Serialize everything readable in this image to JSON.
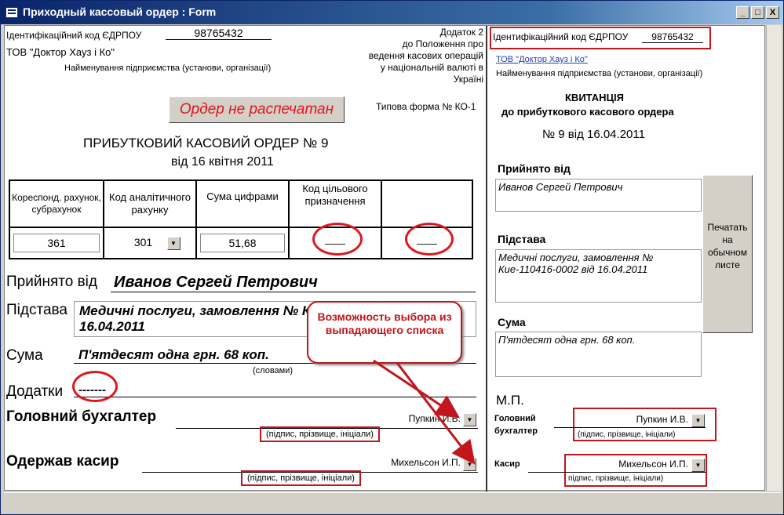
{
  "window": {
    "title": "Приходный кассовый ордер : Form",
    "minimize": "_",
    "restore": "□",
    "close": "X"
  },
  "left": {
    "edrpou_label": "Ідентифікаційний код ЄДРПОУ",
    "edrpou_value": "98765432",
    "org_name": "ТОВ \"Доктор Хауз і Ко\"",
    "org_caption": "Найменування підприємства (установи, організації)",
    "addendum": [
      "Додаток 2",
      "до Положення про",
      "ведення касових операцій",
      "у національній валюті в",
      "Україні"
    ],
    "order_status_button": "Ордер не распечатан",
    "form_type": "Типова форма № КО-1",
    "title_line1": "ПРИБУТКОВИЙ КАСОВИЙ ОРДЕР № 9",
    "title_line2": "від 16 квітня  2011",
    "table_headers": [
      "Кореспонд. рахунок, субрахунок",
      "Код аналітичного рахунку",
      "Сума цифрами",
      "Код цільового призначення",
      ""
    ],
    "table_values": {
      "account": "361",
      "analytic": "301",
      "sum": "51,68",
      "purpose": "——",
      "extra": "——"
    },
    "received_from_label": "Прийнято від",
    "received_from_value": "Иванов Сергей Петрович",
    "basis_label": "Підстава",
    "basis_value": "Медичні послуги, замовлення № Кие-110416-0002 від 16.04.2011",
    "sum_label": "Сума",
    "sum_words": "П'ятдесят одна грн.  68 коп.",
    "words_caption": "(словами)",
    "attachments_label": "Додатки",
    "attachments_value": "-------",
    "chief_label": "Головний бухгалтер",
    "chief_value": "Пупкин И.В.",
    "chief_caption": "(підпис, прізвище, ініціали)",
    "cashier_label": "Одержав касир",
    "cashier_value": "Михельсон И.П.",
    "cashier_caption": "(підпис, прізвище, ініціали)"
  },
  "callout": {
    "text": "Возможность выбора из выпадающего списка"
  },
  "right": {
    "edrpou_label": "Ідентифікаційний код ЄДРПОУ",
    "edrpou_value": "98765432",
    "org_name": "ТОВ \"Доктор Хауз і Ко\"",
    "org_caption": "Найменування підприємства (установи, організації)",
    "receipt_title": "КВИТАНЦІЯ",
    "receipt_subtitle": "до прибуткового касового ордера",
    "receipt_number": "№ 9 від 16.04.2011",
    "received_from_label": "Прийнято від",
    "received_from_value": "Иванов Сергей Петрович",
    "basis_label": "Підстава",
    "basis_value": "Медичні послуги, замовлення № Кие-110416-0002 від 16.04.2011",
    "sum_label": "Сума",
    "sum_value": "П'ятдесят одна грн.  68 коп.",
    "print_button": "Печатать на обычном листе",
    "stamp": "М.П.",
    "chief_label_1": "Головний",
    "chief_label_2": "бухгалтер",
    "chief_value": "Пупкин И.В.",
    "chief_caption": "(підпис, прізвище, ініціали)",
    "cashier_label": "Касир",
    "cashier_value": "Михельсон И.П.",
    "cashier_caption": "підпис, прізвище, ініціали)"
  },
  "colors": {
    "accent_red": "#c0161c",
    "title_blue": "#0a246a",
    "link_blue": "#1f3fae"
  }
}
